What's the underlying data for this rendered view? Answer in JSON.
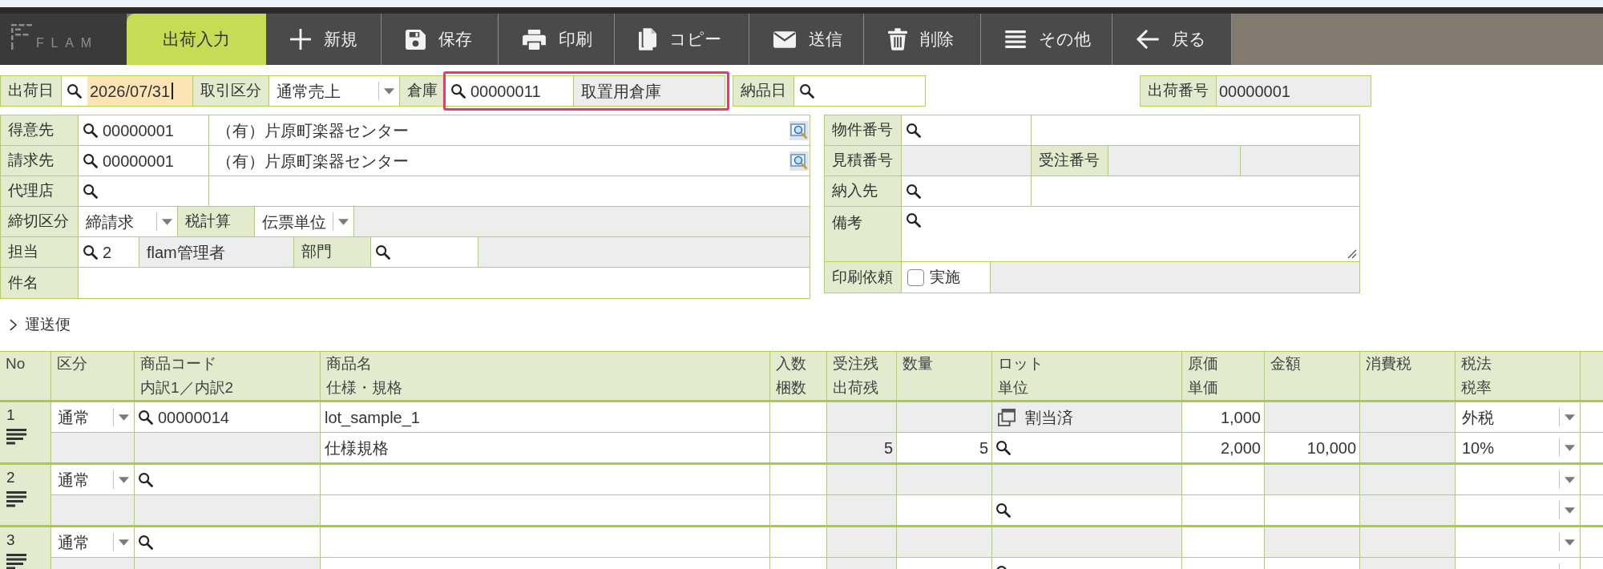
{
  "toolbar": {
    "logo": "FLAM",
    "tabs": [
      {
        "label": "出荷入力",
        "selected": true
      }
    ],
    "buttons": [
      "新規",
      "保存",
      "印刷",
      "コピー",
      "送信",
      "削除",
      "その他",
      "戻る"
    ]
  },
  "header_row": {
    "groups": [
      {
        "fields": [
          {
            "kind": "date",
            "label": "出荷日",
            "value": "2026/07/31",
            "focused": true
          },
          {
            "kind": "select",
            "label": "取引区分",
            "value": "通常売上"
          },
          {
            "kind": "lookup",
            "label": "倉庫",
            "code": "00000011",
            "name": "取置用倉庫",
            "highlighted": true
          }
        ]
      },
      {
        "fields": [
          {
            "kind": "date",
            "label": "納品日",
            "focused": false
          }
        ]
      }
    ],
    "slip_number": {
      "label": "出荷番号",
      "value": "00000001"
    }
  },
  "customer_panel": {
    "rows": [
      {
        "cells": [
          {
            "kind": "label",
            "text": "得意先"
          },
          {
            "kind": "search",
            "value": "00000001"
          },
          {
            "kind": "text",
            "value": "（有）片原町楽器センター",
            "lookup_button": true
          }
        ]
      },
      {
        "cells": [
          {
            "kind": "label",
            "text": "請求先"
          },
          {
            "kind": "search",
            "value": "00000001"
          },
          {
            "kind": "text",
            "value": "（有）片原町楽器センター",
            "lookup_button": true
          }
        ]
      },
      {
        "cells": [
          {
            "kind": "label",
            "text": "代理店"
          },
          {
            "kind": "search"
          },
          {
            "kind": "text",
            "lookup_button": false
          }
        ]
      },
      {
        "cells": [
          {
            "kind": "label",
            "text": "締切区分"
          },
          {
            "kind": "select",
            "value": "締請求"
          },
          {
            "kind": "label",
            "text": "税計算"
          },
          {
            "kind": "select",
            "value": "伝票単位"
          },
          {
            "kind": "readonly"
          }
        ]
      },
      {
        "cells": [
          {
            "kind": "label",
            "text": "担当"
          },
          {
            "kind": "search",
            "value": "2"
          },
          {
            "kind": "readonly",
            "value": "flam管理者"
          },
          {
            "kind": "label",
            "text": "部門"
          },
          {
            "kind": "search"
          },
          {
            "kind": "readonly"
          }
        ]
      },
      {
        "cells": [
          {
            "kind": "label",
            "text": "件名"
          },
          {
            "kind": "text"
          }
        ]
      }
    ]
  },
  "reference_panel": {
    "rows": [
      {
        "cells": [
          {
            "kind": "label",
            "text": "物件番号"
          },
          {
            "kind": "search"
          },
          {
            "kind": "text"
          }
        ]
      },
      {
        "cells": [
          {
            "kind": "label",
            "text": "見積番号"
          },
          {
            "kind": "readonly"
          },
          {
            "kind": "label",
            "text": "受注番号"
          },
          {
            "kind": "readonly"
          },
          {
            "kind": "readonly"
          }
        ]
      },
      {
        "cells": [
          {
            "kind": "label",
            "text": "納入先"
          },
          {
            "kind": "search"
          },
          {
            "kind": "text"
          }
        ]
      },
      {
        "cells": [
          {
            "kind": "label",
            "text": "備考"
          },
          {
            "kind": "textarea"
          }
        ]
      },
      {
        "cells": [
          {
            "kind": "label",
            "text": "印刷依頼"
          },
          {
            "kind": "checkbox",
            "label": "実施",
            "checked": false
          },
          {
            "kind": "readonly"
          }
        ]
      }
    ]
  },
  "shipping_section": {
    "label": "運送便",
    "expanded": false
  },
  "table": {
    "columns": [
      {
        "lines": [
          "No"
        ]
      },
      {
        "lines": [
          "区分"
        ]
      },
      {
        "lines": [
          "商品コード",
          "内訳1／内訳2"
        ]
      },
      {
        "lines": [
          "商品名",
          "仕様・規格"
        ]
      },
      {
        "lines": [
          "入数",
          "梱数"
        ]
      },
      {
        "lines": [
          "受注残",
          "出荷残"
        ]
      },
      {
        "lines": [
          "数量"
        ]
      },
      {
        "lines": [
          "ロット",
          "単位"
        ]
      },
      {
        "lines": [
          "原価",
          "単価"
        ]
      },
      {
        "lines": [
          "金額"
        ]
      },
      {
        "lines": [
          "消費税"
        ]
      },
      {
        "lines": [
          "税法",
          "税率"
        ]
      }
    ],
    "rows": [
      {
        "no": "1",
        "lines": [
          [
            {
              "kind": "select",
              "value": "通常"
            },
            {
              "kind": "search",
              "value": "00000014"
            },
            {
              "kind": "input",
              "value": "lot_sample_1"
            },
            {
              "kind": "input"
            },
            {
              "kind": "readonly"
            },
            {
              "kind": "readonly"
            },
            {
              "kind": "lot",
              "value": "割当済"
            },
            {
              "kind": "input",
              "value": "1,000"
            },
            {
              "kind": "readonly"
            },
            {
              "kind": "readonly"
            },
            {
              "kind": "select",
              "value": "外税"
            }
          ],
          [
            {
              "kind": "readonly"
            },
            {
              "kind": "readonly"
            },
            {
              "kind": "input",
              "value": "仕様規格"
            },
            {
              "kind": "input"
            },
            {
              "kind": "readonly",
              "value": "5"
            },
            {
              "kind": "input",
              "value": "5"
            },
            {
              "kind": "search"
            },
            {
              "kind": "input",
              "value": "2,000"
            },
            {
              "kind": "input",
              "value": "10,000"
            },
            {
              "kind": "readonly"
            },
            {
              "kind": "select",
              "value": "10%"
            }
          ]
        ]
      },
      {
        "no": "2",
        "lines": [
          [
            {
              "kind": "select",
              "value": "通常"
            },
            {
              "kind": "search"
            },
            {
              "kind": "input"
            },
            {
              "kind": "input"
            },
            {
              "kind": "readonly"
            },
            {
              "kind": "readonly"
            },
            {
              "kind": "readonly"
            },
            {
              "kind": "input"
            },
            {
              "kind": "readonly"
            },
            {
              "kind": "readonly"
            },
            {
              "kind": "select"
            }
          ],
          [
            {
              "kind": "readonly"
            },
            {
              "kind": "readonly"
            },
            {
              "kind": "input"
            },
            {
              "kind": "input"
            },
            {
              "kind": "readonly"
            },
            {
              "kind": "input"
            },
            {
              "kind": "search"
            },
            {
              "kind": "input"
            },
            {
              "kind": "input"
            },
            {
              "kind": "readonly"
            },
            {
              "kind": "select"
            }
          ]
        ]
      },
      {
        "no": "3",
        "lines": [
          [
            {
              "kind": "select",
              "value": "通常"
            },
            {
              "kind": "search"
            },
            {
              "kind": "input"
            },
            {
              "kind": "input"
            },
            {
              "kind": "readonly"
            },
            {
              "kind": "readonly"
            },
            {
              "kind": "readonly"
            },
            {
              "kind": "input"
            },
            {
              "kind": "readonly"
            },
            {
              "kind": "readonly"
            },
            {
              "kind": "select"
            }
          ],
          [
            {
              "kind": "readonly"
            },
            {
              "kind": "readonly"
            },
            {
              "kind": "input"
            },
            {
              "kind": "input"
            },
            {
              "kind": "readonly"
            },
            {
              "kind": "input"
            },
            {
              "kind": "search"
            },
            {
              "kind": "input"
            },
            {
              "kind": "input"
            },
            {
              "kind": "readonly"
            },
            {
              "kind": "select"
            }
          ]
        ]
      }
    ]
  }
}
